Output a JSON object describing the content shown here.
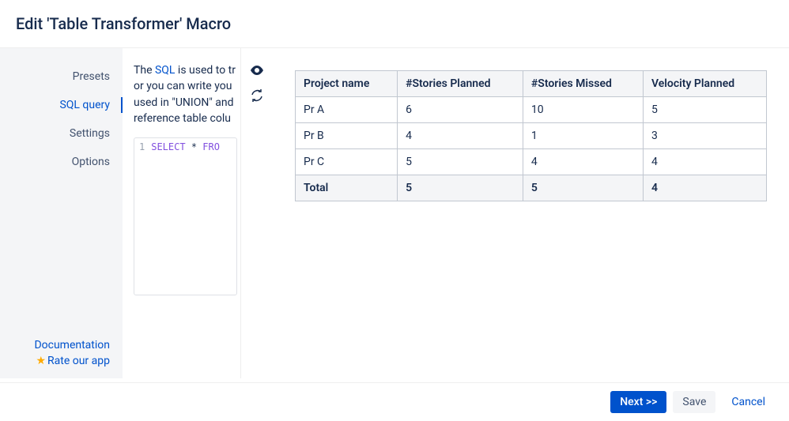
{
  "header": {
    "title": "Edit 'Table Transformer' Macro"
  },
  "sidebar": {
    "items": [
      {
        "label": "Presets"
      },
      {
        "label": "SQL query"
      },
      {
        "label": "Settings"
      },
      {
        "label": "Options"
      }
    ],
    "active_index": 1,
    "doc_link": "Documentation",
    "rate_link": "Rate our app"
  },
  "editor": {
    "desc_parts": {
      "pre": "The ",
      "sql": "SQL",
      "line1b": " is used to tr",
      "line2": "or you can write you",
      "line3": "used in \"UNION\" and",
      "line4": "reference table colu"
    },
    "code": {
      "line_no": "1",
      "kw1": "SELECT",
      "star": " * ",
      "kw2": "FRO"
    }
  },
  "table": {
    "headers": [
      "Project name",
      "#Stories Planned",
      "#Stories Missed",
      "Velocity Planned"
    ],
    "rows": [
      [
        "Pr A",
        "6",
        "10",
        "5"
      ],
      [
        "Pr B",
        "4",
        "1",
        "3"
      ],
      [
        "Pr C",
        "5",
        "4",
        "4"
      ]
    ],
    "total_label": "Total",
    "total_values": [
      "5",
      "5",
      "4"
    ]
  },
  "footer": {
    "next": "Next >>",
    "save": "Save",
    "cancel": "Cancel"
  },
  "chart_data": {
    "type": "table",
    "title": "Edit 'Table Transformer' Macro",
    "columns": [
      "Project name",
      "#Stories Planned",
      "#Stories Missed",
      "Velocity Planned"
    ],
    "rows": [
      {
        "Project name": "Pr A",
        "#Stories Planned": 6,
        "#Stories Missed": 10,
        "Velocity Planned": 5
      },
      {
        "Project name": "Pr B",
        "#Stories Planned": 4,
        "#Stories Missed": 1,
        "Velocity Planned": 3
      },
      {
        "Project name": "Pr C",
        "#Stories Planned": 5,
        "#Stories Missed": 4,
        "Velocity Planned": 4
      },
      {
        "Project name": "Total",
        "#Stories Planned": 5,
        "#Stories Missed": 5,
        "Velocity Planned": 4
      }
    ]
  }
}
